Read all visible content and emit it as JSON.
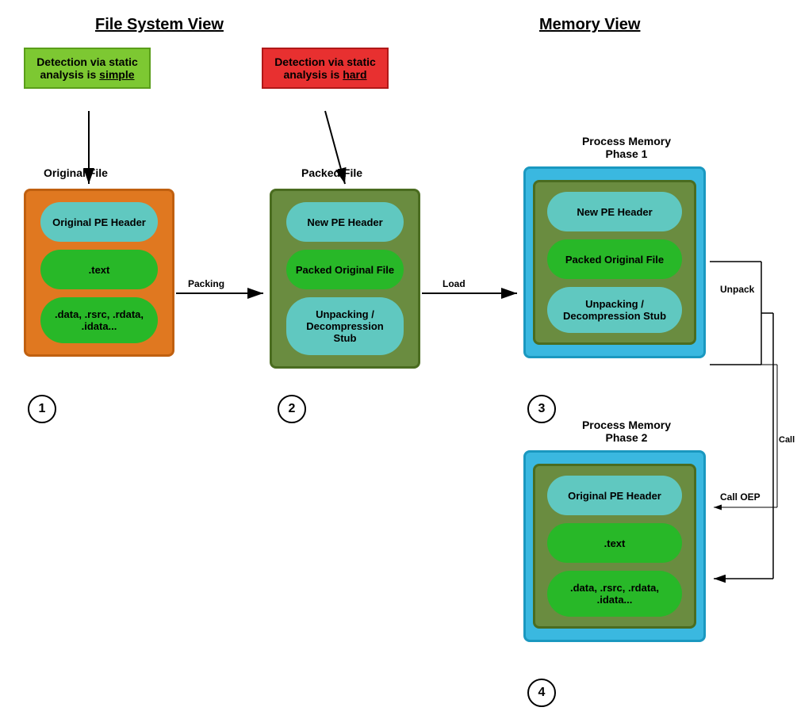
{
  "titles": {
    "filesystem": "File System View",
    "memory": "Memory View"
  },
  "badges": {
    "green": {
      "line1": "Detection via static",
      "line2": "analysis is ",
      "emphasis": "simple"
    },
    "red": {
      "line1": "Detection via static",
      "line2": "analysis is ",
      "emphasis": "hard"
    }
  },
  "block1": {
    "label": "Original File",
    "items": [
      "Original PE Header",
      ".text",
      ".data, .rsrc, .rdata,\n.idata..."
    ],
    "number": "1"
  },
  "block2": {
    "label": "Packed File",
    "items": [
      "New PE Header",
      "Packed Original File",
      "Unpacking /\nDecompression Stub"
    ],
    "number": "2"
  },
  "block3": {
    "label": "Process Memory\nPhase 1",
    "items": [
      "New PE Header",
      "Packed Original File",
      "Unpacking /\nDecompression Stub"
    ],
    "number": "3"
  },
  "block4": {
    "label": "Process Memory\nPhase 2",
    "items": [
      "Original PE Header",
      ".text",
      ".data, .rsrc, .rdata,\n.idata..."
    ],
    "number": "4"
  },
  "arrows": {
    "packing": "Packing",
    "load": "Load",
    "unpack": "Unpack",
    "calloep": "Call OEP"
  }
}
